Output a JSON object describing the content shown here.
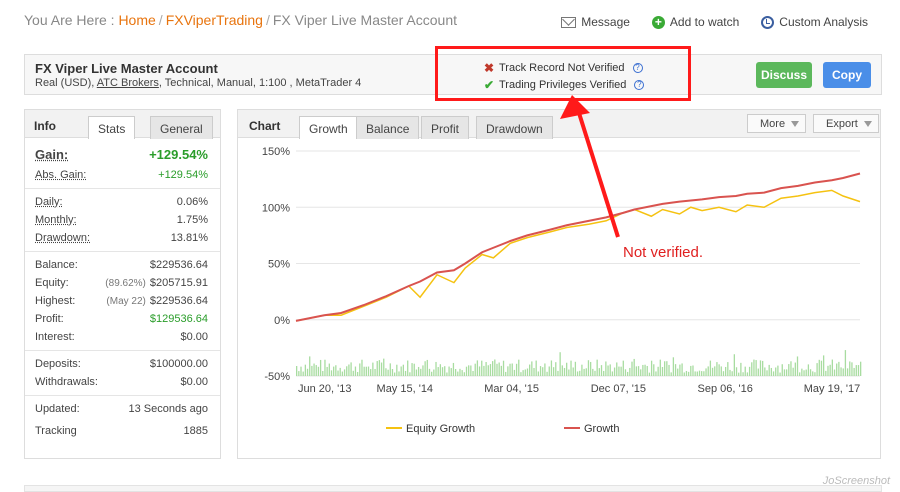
{
  "breadcrumb": {
    "prefix": "You Are Here :",
    "home": "Home",
    "user": "FXViperTrading",
    "current": "FX Viper Live Master Account"
  },
  "top_actions": {
    "message": "Message",
    "watch": "Add to watch",
    "analysis": "Custom Analysis"
  },
  "account": {
    "name": "FX Viper Live Master Account",
    "sub_before": "Real (USD), ",
    "broker": "ATC Brokers",
    "sub_after": ", Technical, Manual, 1:100 , MetaTrader 4",
    "track_record": "Track Record Not Verified",
    "privileges": "Trading Privileges Verified",
    "discuss": "Discuss",
    "copy": "Copy"
  },
  "info": {
    "title": "Info",
    "tab_stats": "Stats",
    "tab_general": "General",
    "gain_label": "Gain:",
    "gain_value": "+129.54%",
    "abs_gain_label": "Abs. Gain:",
    "abs_gain_value": "+129.54%",
    "daily_label": "Daily:",
    "daily_value": "0.06%",
    "monthly_label": "Monthly:",
    "monthly_value": "1.75%",
    "drawdown_label": "Drawdown:",
    "drawdown_value": "13.81%",
    "balance_label": "Balance:",
    "balance_value": "$229536.64",
    "equity_label": "Equity:",
    "equity_note": "(89.62%)",
    "equity_value": "$205715.91",
    "highest_label": "Highest:",
    "highest_note": "(May 22)",
    "highest_value": "$229536.64",
    "profit_label": "Profit:",
    "profit_value": "$129536.64",
    "interest_label": "Interest:",
    "interest_value": "$0.00",
    "deposits_label": "Deposits:",
    "deposits_value": "$100000.00",
    "withdrawals_label": "Withdrawals:",
    "withdrawals_value": "$0.00",
    "updated_label": "Updated:",
    "updated_value": "13 Seconds ago",
    "tracking_label": "Tracking",
    "tracking_value": "1885"
  },
  "chart": {
    "title": "Chart",
    "tabs": [
      "Growth",
      "Balance",
      "Profit",
      "Drawdown"
    ],
    "more": "More",
    "export": "Export",
    "annotation": "Not verified."
  },
  "watermark": "JoScreenshot",
  "chart_data": {
    "type": "line",
    "x_ticks": [
      "Jun 20, '13",
      "May 15, '14",
      "Mar 04, '15",
      "Dec 07, '15",
      "Sep 06, '16",
      "May 19, '17"
    ],
    "y_ticks": [
      "150%",
      "100%",
      "50%",
      "0%",
      "-50%"
    ],
    "ylim": [
      -50,
      150
    ],
    "series": [
      {
        "name": "Equity Growth",
        "color": "#f5c211",
        "x": [
          0,
          0.05,
          0.08,
          0.12,
          0.16,
          0.2,
          0.22,
          0.25,
          0.28,
          0.3,
          0.33,
          0.35,
          0.38,
          0.41,
          0.45,
          0.48,
          0.52,
          0.55,
          0.58,
          0.6,
          0.63,
          0.65,
          0.68,
          0.7,
          0.72,
          0.75,
          0.78,
          0.8,
          0.83,
          0.86,
          0.89,
          0.92,
          0.95,
          0.97,
          1.0
        ],
        "y": [
          -1,
          4,
          4,
          12,
          20,
          30,
          20,
          40,
          33,
          46,
          58,
          55,
          68,
          73,
          78,
          82,
          85,
          88,
          95,
          98,
          92,
          98,
          94,
          100,
          97,
          100,
          96,
          102,
          100,
          108,
          110,
          113,
          115,
          110,
          105
        ]
      },
      {
        "name": "Growth",
        "color": "#d9534f",
        "x": [
          0,
          0.05,
          0.08,
          0.12,
          0.16,
          0.2,
          0.22,
          0.25,
          0.28,
          0.3,
          0.33,
          0.35,
          0.38,
          0.41,
          0.45,
          0.48,
          0.52,
          0.55,
          0.58,
          0.6,
          0.63,
          0.65,
          0.68,
          0.7,
          0.72,
          0.75,
          0.78,
          0.8,
          0.83,
          0.86,
          0.89,
          0.92,
          0.95,
          0.97,
          1.0
        ],
        "y": [
          -1,
          4,
          6,
          13,
          21,
          30,
          34,
          42,
          44,
          50,
          60,
          64,
          70,
          75,
          80,
          84,
          88,
          91,
          95,
          98,
          101,
          103,
          105,
          106,
          107,
          109,
          110,
          112,
          113,
          117,
          119,
          122,
          124,
          126,
          130
        ]
      }
    ],
    "volume_range": [
      -50,
      -30
    ]
  }
}
